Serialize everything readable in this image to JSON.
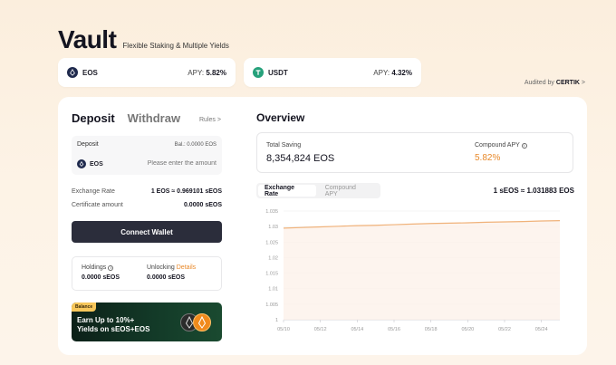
{
  "header": {
    "title": "Vault",
    "subtitle": "Flexible Staking & Multiple Yields"
  },
  "tokens": [
    {
      "name": "EOS",
      "apy_label": "APY:",
      "apy_value": "5.82%",
      "icon": "eos-coin-icon",
      "color": "#1f2a4d"
    },
    {
      "name": "USDT",
      "apy_label": "APY:",
      "apy_value": "4.32%",
      "icon": "usdt-coin-icon",
      "color": "#26a17b"
    }
  ],
  "audited": {
    "prefix": "Audited by",
    "brand": "CERTIK",
    "arrow": ">"
  },
  "left": {
    "tab_deposit": "Deposit",
    "tab_withdraw": "Withdraw",
    "rules": "Rules >",
    "deposit_label": "Deposit",
    "balance": "Bal.: 0.0000 EOS",
    "token": "EOS",
    "amount_placeholder": "Please enter the amount",
    "exchange_rate_label": "Exchange Rate",
    "exchange_rate_value": "1 EOS ≈ 0.969101 sEOS",
    "certificate_label": "Certificate amount",
    "certificate_value": "0.0000 sEOS",
    "connect_label": "Connect Wallet",
    "holdings_label": "Holdings",
    "holdings_value": "0.0000 sEOS",
    "unlocking_label": "Unlocking",
    "details_label": "Details",
    "unlocking_value": "0.0000 sEOS"
  },
  "banner": {
    "badge": "Balance",
    "line1": "Earn Up to 10%+",
    "line2": "Yields on sEOS+EOS"
  },
  "overview": {
    "title": "Overview",
    "total_saving_label": "Total Saving",
    "total_saving_value": "8,354,824 EOS",
    "compound_apy_label": "Compound APY",
    "compound_apy_value": "5.82%",
    "seg_on": "Exchange Rate",
    "seg_off": "Compound APY",
    "rate": "1 sEOS ≈ 1.031883 EOS"
  },
  "colors": {
    "accent": "#e8892a",
    "button": "#2b2d3b"
  },
  "chart_data": {
    "type": "area",
    "x": [
      "05/10",
      "05/11",
      "05/12",
      "05/13",
      "05/14",
      "05/15",
      "05/16",
      "05/17",
      "05/18",
      "05/19",
      "05/20",
      "05/21",
      "05/22",
      "05/23",
      "05/24",
      "05/25"
    ],
    "x_ticks": [
      "05/10",
      "05/12",
      "05/14",
      "05/16",
      "05/18",
      "05/20",
      "05/22",
      "05/24"
    ],
    "values": [
      1.0295,
      1.0297,
      1.0299,
      1.0301,
      1.0303,
      1.0304,
      1.0306,
      1.0308,
      1.031,
      1.0311,
      1.0312,
      1.0314,
      1.0315,
      1.0316,
      1.0318,
      1.0319
    ],
    "y_ticks": [
      "1",
      "1.005",
      "1.01",
      "1.015",
      "1.02",
      "1.025",
      "1.03",
      "1.035"
    ],
    "ylim": [
      1,
      1.035
    ],
    "grid": true,
    "line_color": "#f0b27a"
  }
}
